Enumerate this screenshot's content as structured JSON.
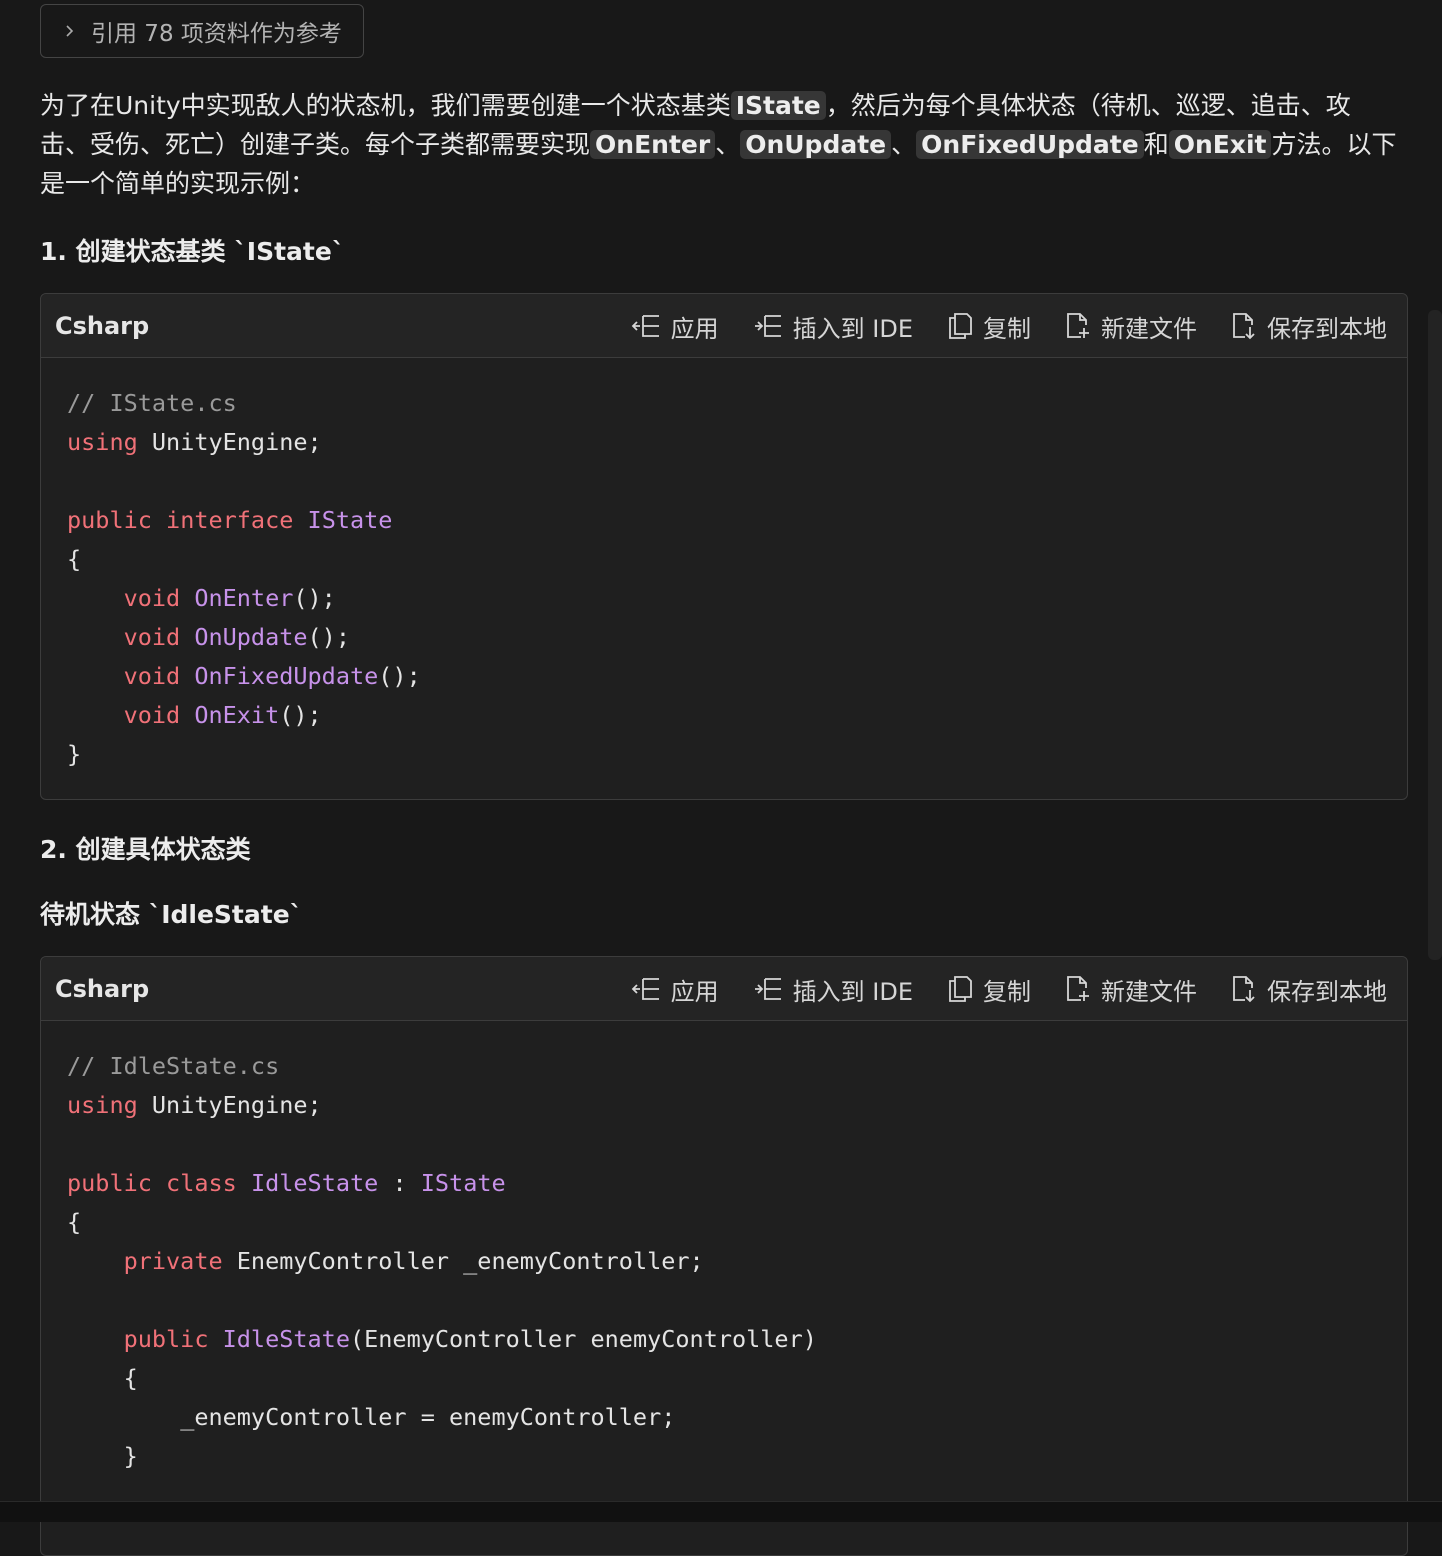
{
  "references": {
    "label": "引用 78 项资料作为参考"
  },
  "intro": {
    "t1": "为了在Unity中实现敌人的状态机，我们需要创建一个状态基类",
    "c1": "IState",
    "t2": "，然后为每个具体状态（待机、巡逻、追击、攻击、受伤、死亡）创建子类。每个子类都需要实现",
    "c2": "OnEnter",
    "t3": "、",
    "c3": "OnUpdate",
    "t4": "、",
    "c4": "OnFixedUpdate",
    "t5": "和",
    "c5": "OnExit",
    "t6": "方法。以下是一个简单的实现示例："
  },
  "headings": {
    "h1": "1. 创建状态基类 `IState`",
    "h2": "2. 创建具体状态类",
    "h3": "待机状态 `IdleState`"
  },
  "codeblock_actions": {
    "lang": "Csharp",
    "apply": "应用",
    "insert": "插入到 IDE",
    "copy": "复制",
    "new_file": "新建文件",
    "save_local": "保存到本地"
  },
  "code1": {
    "l1": "// IState.cs",
    "l2_kw": "using",
    "l2_rest": " UnityEngine;",
    "l4_kw1": "public",
    "l4_kw2": "interface",
    "l4_ty": "IState",
    "l5": "{",
    "m1_kw": "void",
    "m1_fn": "OnEnter",
    "m1_rest": "();",
    "m2_kw": "void",
    "m2_fn": "OnUpdate",
    "m2_rest": "();",
    "m3_kw": "void",
    "m3_fn": "OnFixedUpdate",
    "m3_rest": "();",
    "m4_kw": "void",
    "m4_fn": "OnExit",
    "m4_rest": "();",
    "l10": "}"
  },
  "code2": {
    "l1": "// IdleState.cs",
    "l2_kw": "using",
    "l2_rest": " UnityEngine;",
    "l4_kw1": "public",
    "l4_kw2": "class",
    "l4_ty": "IdleState",
    "l4_sep": " : ",
    "l4_base": "IState",
    "l5": "{",
    "f_kw": "private",
    "f_rest": " EnemyController _enemyController;",
    "ctor_kw": "public",
    "ctor_fn": "IdleState",
    "ctor_rest": "(EnemyController enemyController)",
    "ob": "{",
    "assign": "_enemyController = enemyController;",
    "cb": "}"
  }
}
